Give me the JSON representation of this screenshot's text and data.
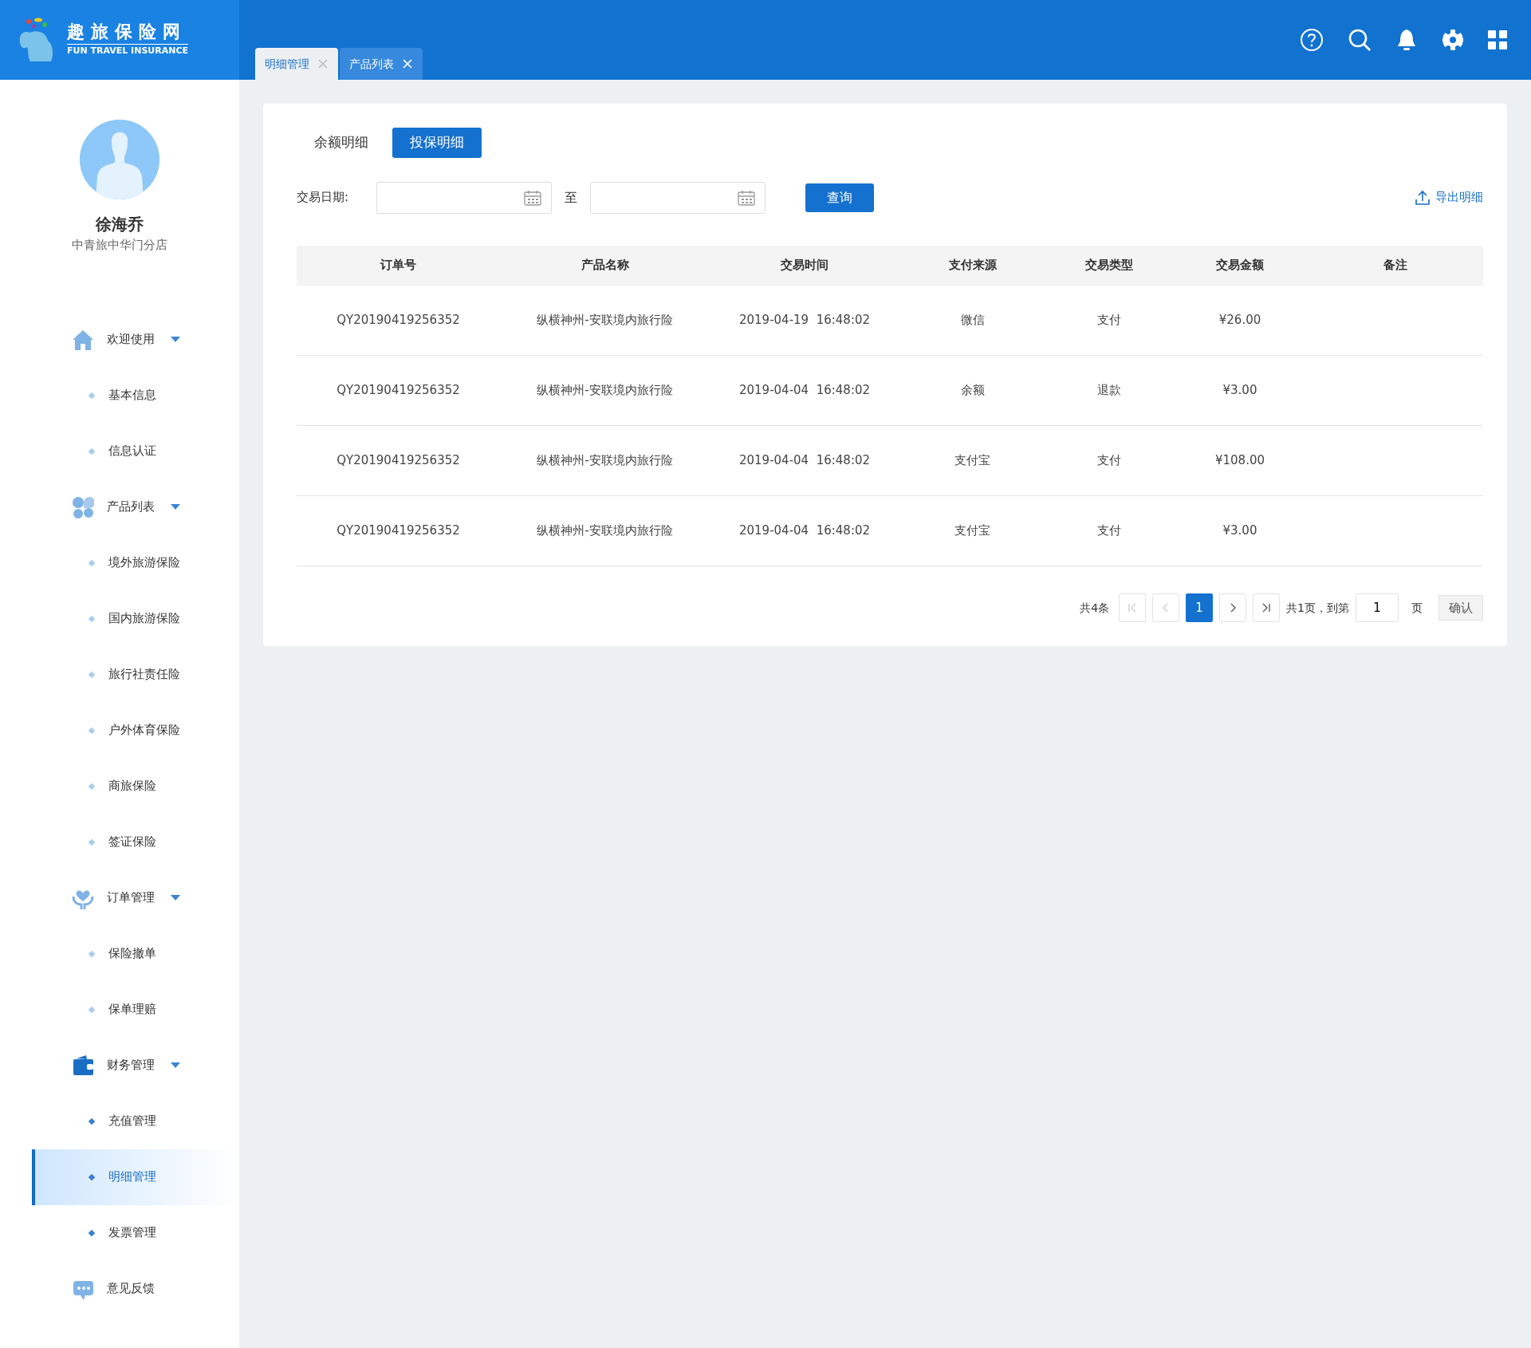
{
  "brand": {
    "title": "趣旅保险网",
    "subtitle": "FUN TRAVEL INSURANCE"
  },
  "page_tabs": [
    {
      "label": "明细管理",
      "selected": true
    },
    {
      "label": "产品列表",
      "selected": false
    }
  ],
  "user": {
    "name": "徐海乔",
    "store": "中青旅中华门分店"
  },
  "sidebar": {
    "items": [
      {
        "label": "欢迎使用",
        "children": [
          {
            "label": "基本信息",
            "selected": false
          },
          {
            "label": "信息认证",
            "selected": false
          }
        ]
      },
      {
        "label": "产品列表",
        "children": [
          {
            "label": "境外旅游保险",
            "selected": false
          },
          {
            "label": "国内旅游保险",
            "selected": false
          },
          {
            "label": "旅行社责任险",
            "selected": false
          },
          {
            "label": "户外体育保险",
            "selected": false
          },
          {
            "label": "商旅保险",
            "selected": false
          },
          {
            "label": "签证保险",
            "selected": false
          }
        ]
      },
      {
        "label": "订单管理",
        "children": [
          {
            "label": "保险撤单",
            "selected": false
          },
          {
            "label": "保单理赔",
            "selected": false
          }
        ]
      },
      {
        "label": "财务管理",
        "children": [
          {
            "label": "充值管理",
            "selected": false
          },
          {
            "label": "明细管理",
            "selected": true
          },
          {
            "label": "发票管理",
            "selected": false
          }
        ]
      },
      {
        "label": "意见反馈"
      }
    ]
  },
  "sub_tabs": [
    {
      "label": "余额明细",
      "selected": false
    },
    {
      "label": "投保明细",
      "selected": true
    }
  ],
  "filter": {
    "label": "交易日期:",
    "separator": "至",
    "query_button": "查询",
    "export_link": "导出明细"
  },
  "table": {
    "columns": [
      "订单号",
      "产品名称",
      "交易时间",
      "支付来源",
      "交易类型",
      "交易金额",
      "备注"
    ],
    "rows": [
      [
        "QY20190419256352",
        "纵横神州-安联境内旅行险",
        "2019-04-19  16:48:02",
        "微信",
        "支付",
        "¥26.00",
        ""
      ],
      [
        "QY20190419256352",
        "纵横神州-安联境内旅行险",
        "2019-04-04  16:48:02",
        "余额",
        "退款",
        "¥3.00",
        ""
      ],
      [
        "QY20190419256352",
        "纵横神州-安联境内旅行险",
        "2019-04-04  16:48:02",
        "支付宝",
        "支付",
        "¥108.00",
        ""
      ],
      [
        "QY20190419256352",
        "纵横神州-安联境内旅行险",
        "2019-04-04  16:48:02",
        "支付宝",
        "支付",
        "¥3.00",
        ""
      ]
    ]
  },
  "pagination": {
    "total": "共4条",
    "first": {
      "disabled": true
    },
    "prev": {
      "disabled": true
    },
    "pages": [
      {
        "label": "1",
        "selected": true
      }
    ],
    "next": {
      "disabled": false
    },
    "last": {
      "disabled": false
    },
    "pages_total": "共1页，到第",
    "jump_value": "1",
    "page_unit": "页",
    "confirm": "确认"
  }
}
